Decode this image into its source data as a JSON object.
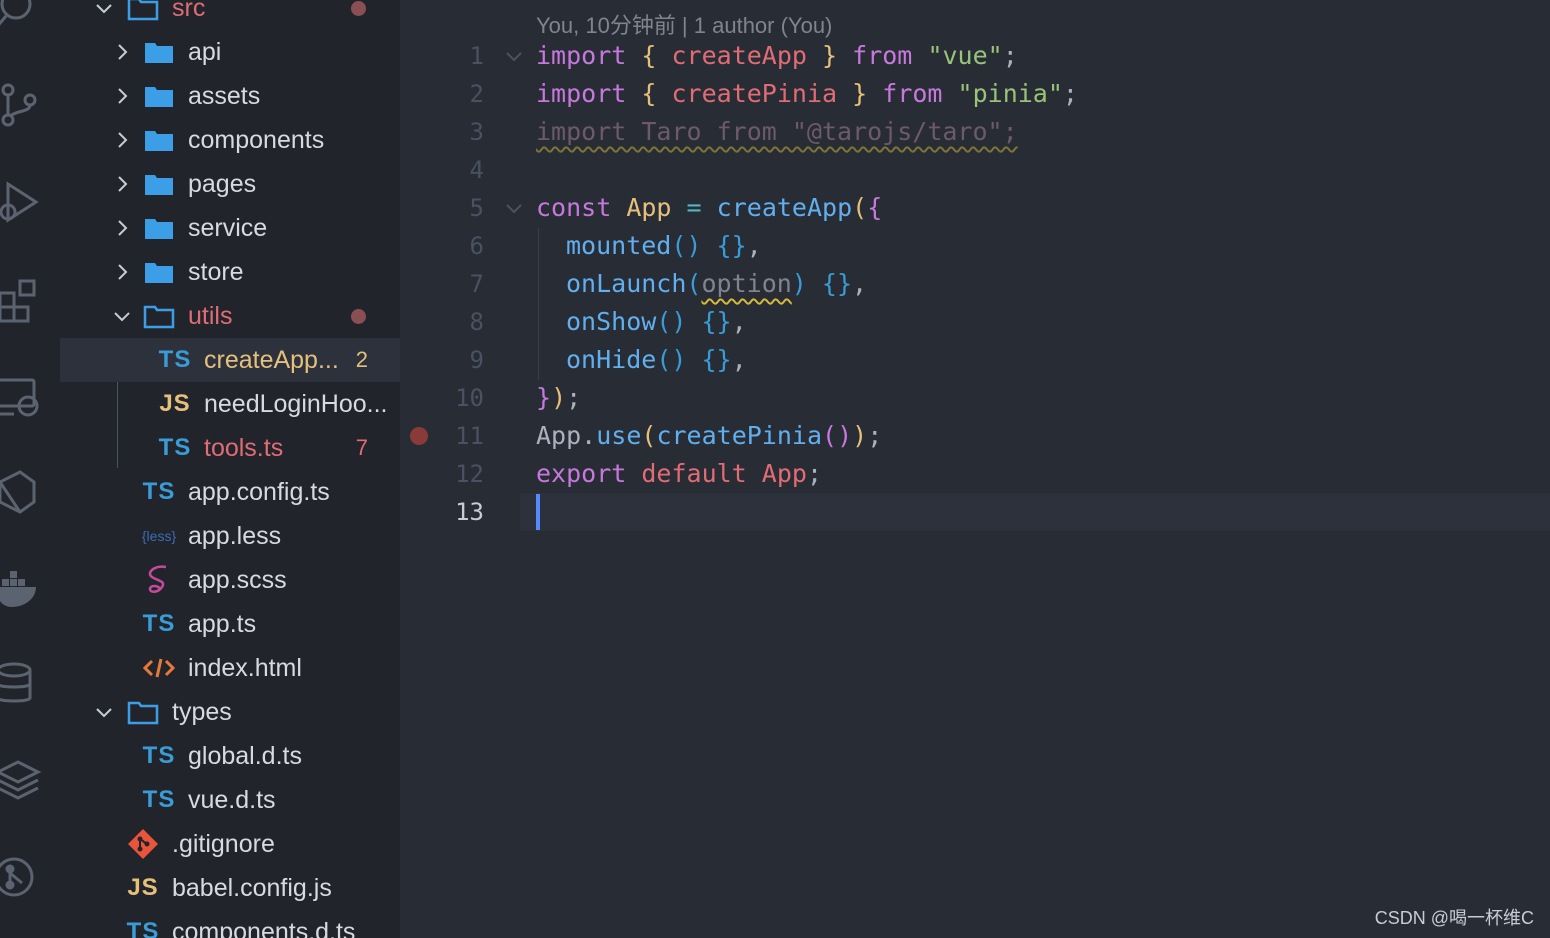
{
  "explorer": {
    "items": [
      {
        "label": "src",
        "kind": "folder-open",
        "state": "error",
        "has_dot": true
      },
      {
        "label": "api",
        "kind": "folder"
      },
      {
        "label": "assets",
        "kind": "folder"
      },
      {
        "label": "components",
        "kind": "folder"
      },
      {
        "label": "pages",
        "kind": "folder"
      },
      {
        "label": "service",
        "kind": "folder"
      },
      {
        "label": "store",
        "kind": "folder"
      },
      {
        "label": "utils",
        "kind": "folder-open",
        "state": "error",
        "has_dot": true
      },
      {
        "label": "createApp...",
        "kind": "ts",
        "state": "warn",
        "badge": "2",
        "active": true
      },
      {
        "label": "needLoginHoo...",
        "kind": "js"
      },
      {
        "label": "tools.ts",
        "kind": "ts",
        "state": "error",
        "badge": "7"
      },
      {
        "label": "app.config.ts",
        "kind": "ts"
      },
      {
        "label": "app.less",
        "kind": "less"
      },
      {
        "label": "app.scss",
        "kind": "scss"
      },
      {
        "label": "app.ts",
        "kind": "ts"
      },
      {
        "label": "index.html",
        "kind": "html"
      },
      {
        "label": "types",
        "kind": "folder-open"
      },
      {
        "label": "global.d.ts",
        "kind": "ts"
      },
      {
        "label": "vue.d.ts",
        "kind": "ts"
      },
      {
        "label": ".gitignore",
        "kind": "git"
      },
      {
        "label": "babel.config.js",
        "kind": "js"
      },
      {
        "label": "components.d.ts",
        "kind": "ts"
      }
    ],
    "icon_text": {
      "ts": "TS",
      "js": "JS",
      "less": "{less}"
    }
  },
  "editor": {
    "blame": "You, 10分钟前 | 1 author (You)",
    "line_numbers": [
      "1",
      "2",
      "3",
      "4",
      "5",
      "6",
      "7",
      "8",
      "9",
      "10",
      "11",
      "12",
      "13"
    ],
    "current_line": "13",
    "tokens": {
      "import": "import",
      "lbrace": "{",
      "rbrace": "}",
      "createApp": "createApp",
      "createPinia": "createPinia",
      "from": "from",
      "vue_str": "\"vue\"",
      "pinia_str": "\"pinia\"",
      "semi": ";",
      "line3": "import Taro from \"@tarojs/taro\";",
      "const": "const",
      "App": "App",
      "eq": "=",
      "lparen": "(",
      "rparen": ")",
      "mounted": "mounted",
      "onLaunch": "onLaunch",
      "option": "option",
      "onShow": "onShow",
      "onHide": "onHide",
      "emptybody": "{}",
      "comma": ",",
      "close": "}",
      "closeparen": ")",
      "dot": ".",
      "use": "use",
      "parens": "()",
      "export": "export",
      "default": "default"
    }
  },
  "colors": {
    "error": "#e06c75",
    "warning": "#e5c07b",
    "cursor": "#528bff"
  },
  "activity_icons": [
    "search-icon",
    "source-control-icon",
    "run-debug-icon",
    "extensions-icon",
    "remote-explorer-icon",
    "vscode-icon",
    "docker-icon",
    "database-icon",
    "layers-icon",
    "git-graph-icon"
  ],
  "watermark": "CSDN @喝一杯维C"
}
